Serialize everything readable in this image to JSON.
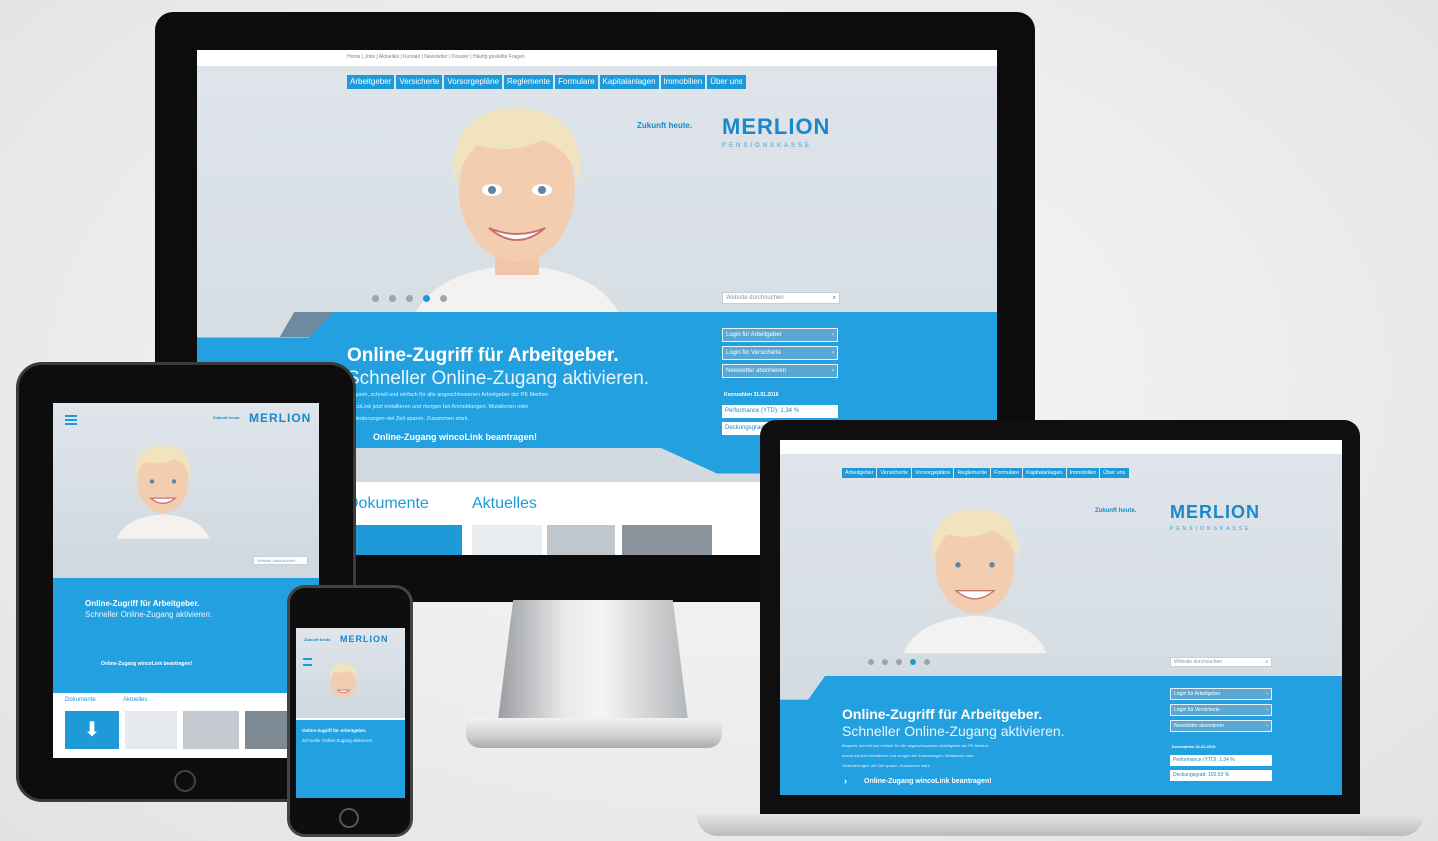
{
  "site": {
    "utility_nav": [
      "Home",
      "Jobs",
      "Aktuelles",
      "Kontakt",
      "Newsletter",
      "Dossier",
      "Häufig gestellte Fragen"
    ],
    "main_nav": [
      "Arbeitgeber",
      "Versicherte",
      "Vorsorgepläne",
      "Reglemente",
      "Formulare",
      "Kapitalanlagen",
      "Immobilien",
      "Über uns"
    ],
    "slogan": "Zukunft heute.",
    "logo": "MERLION",
    "logo_sub": "PENSIONSKASSE",
    "search_placeholder": "Website durchsuchen",
    "headline": "Online-Zugriff für Arbeitgeber.",
    "subheadline": "Schneller Online-Zugang aktivieren.",
    "body_lines": [
      "Bequem, schnell und einfach für alle angeschlossenen Arbeitgeber der PK Merlion:",
      "wincoLink jetzt installieren und morgen bei Anmeldungen, Mutationen oder",
      "Veränderungen viel Zeit sparen. Zusammen stark."
    ],
    "cta": "Online-Zugang wincoLink beantragen!",
    "side_buttons": [
      "Login für Arbeitgeber",
      "Login für Versicherte",
      "Newsletter abonnieren"
    ],
    "stats_date": "Kennzahlen 31.01.2016",
    "stats": [
      "Performance (YTD): 1.34 %",
      "Deckungsgrad: 102.53 %"
    ],
    "tabs": [
      "Dokumente",
      "Aktuelles"
    ],
    "slider": {
      "count": 5,
      "active_index": 3
    }
  },
  "colors": {
    "primary_blue": "#1e9ad8",
    "band_blue": "#22a0e0",
    "logo_blue": "#1a88c9",
    "device_black": "#111111",
    "aluminium": "#c9ccd0"
  }
}
